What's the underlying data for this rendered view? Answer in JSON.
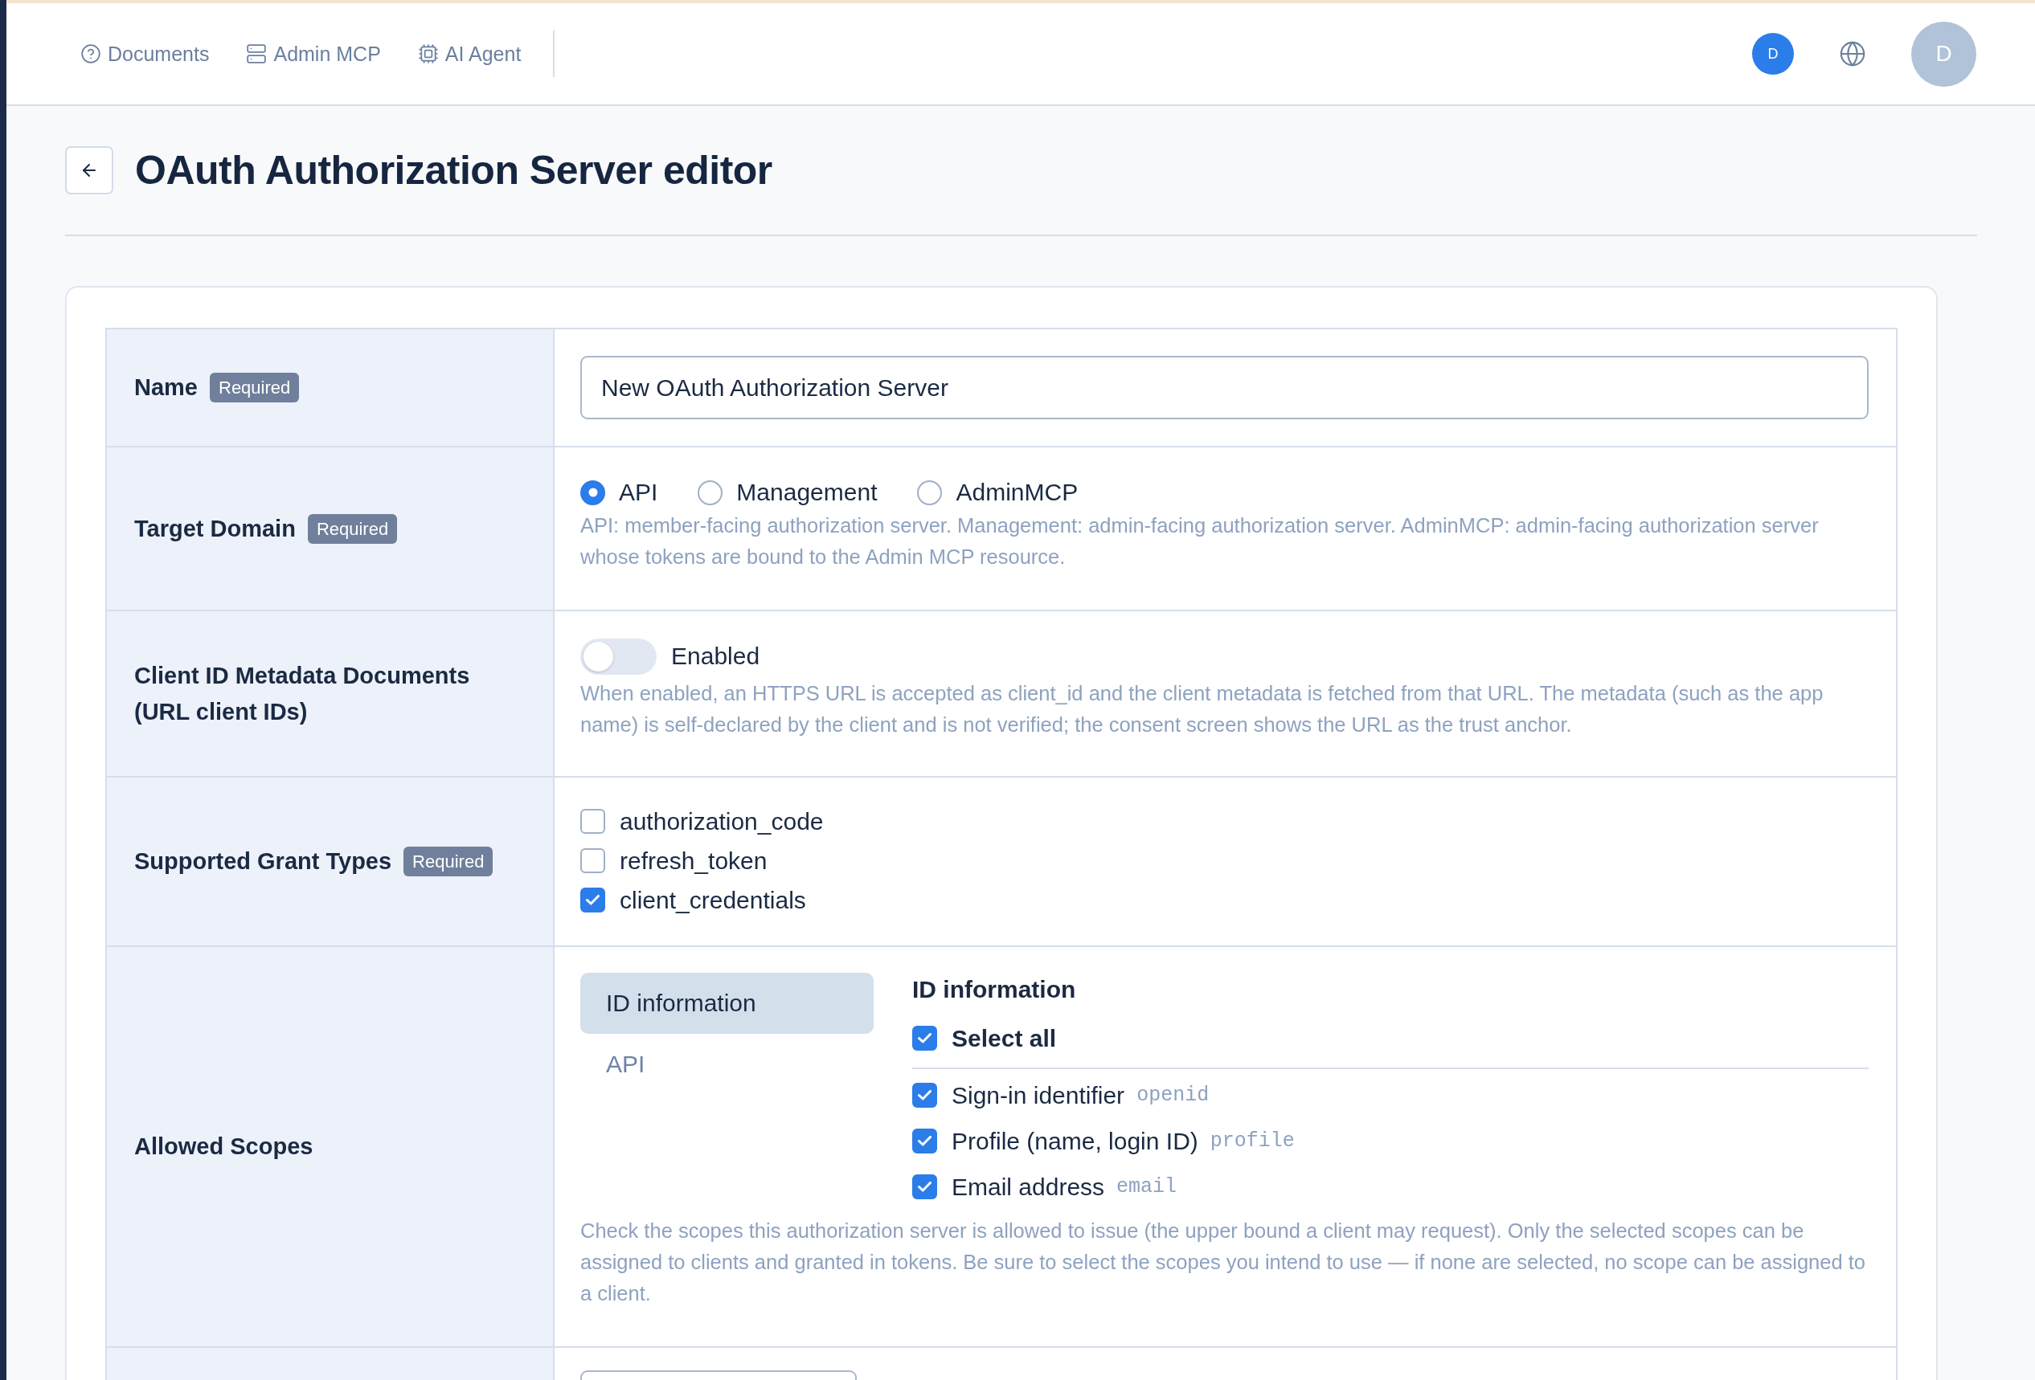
{
  "header": {
    "nav": [
      {
        "label": "Documents"
      },
      {
        "label": "Admin MCP"
      },
      {
        "label": "AI Agent"
      }
    ],
    "tenant": {
      "initial": "D"
    },
    "user": {
      "initial": "D"
    }
  },
  "page": {
    "title": "OAuth Authorization Server editor"
  },
  "form": {
    "rows": [
      {
        "kind": "text",
        "label": "Name",
        "badge": "Required",
        "value": "New OAuth Authorization Server"
      },
      {
        "kind": "radio",
        "label": "Target Domain",
        "badge": "Required",
        "options": [
          {
            "label": "API",
            "selected": true
          },
          {
            "label": "Management",
            "selected": false
          },
          {
            "label": "AdminMCP",
            "selected": false
          }
        ],
        "description": "API: member-facing authorization server. Management: admin-facing authorization server. AdminMCP: admin-facing authorization server whose tokens are bound to the Admin MCP resource."
      },
      {
        "kind": "toggle",
        "label": "Client ID Metadata Documents (URL client IDs)",
        "toggle": {
          "label": "Enabled",
          "on": false
        },
        "description": "When enabled, an HTTPS URL is accepted as client_id and the client metadata is fetched from that URL. The metadata (such as the app name) is self-declared by the client and is not verified; the consent screen shows the URL as the trust anchor."
      },
      {
        "kind": "checkboxes",
        "label": "Supported Grant Types",
        "badge": "Required",
        "options": [
          {
            "label": "authorization_code",
            "checked": false
          },
          {
            "label": "refresh_token",
            "checked": false
          },
          {
            "label": "client_credentials",
            "checked": true
          }
        ]
      },
      {
        "kind": "scopes",
        "label": "Allowed Scopes",
        "groups": [
          {
            "label": "ID information",
            "selected": true
          },
          {
            "label": "API",
            "selected": false
          }
        ],
        "panel": {
          "heading": "ID information",
          "select_all": {
            "label": "Select all",
            "checked": true
          },
          "scopes": [
            {
              "label": "Sign-in identifier",
              "code": "openid",
              "checked": true
            },
            {
              "label": "Profile (name, login ID)",
              "code": "profile",
              "checked": true
            },
            {
              "label": "Email address",
              "code": "email",
              "checked": true
            }
          ]
        },
        "description": "Check the scopes this authorization server is allowed to issue (the upper bound a client may request). Only the selected scopes can be assigned to clients and granted in tokens. Be sure to select the scopes you intend to use — if none are selected, no scope can be assigned to a client."
      },
      {
        "kind": "partial"
      }
    ]
  }
}
